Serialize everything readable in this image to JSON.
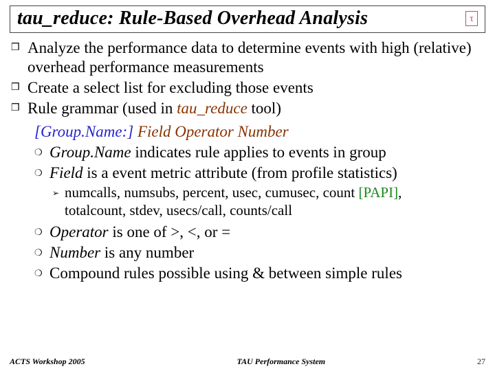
{
  "title": "tau_reduce: Rule-Based Overhead Analysis",
  "tau_mark": "τ",
  "bullets": {
    "b1": "Analyze the performance data to determine events with high (relative) overhead performance measurements",
    "b2": "Create a select list for excluding those events",
    "b3_pre": "Rule grammar (used in ",
    "b3_tool": "tau_reduce",
    "b3_post": " tool)"
  },
  "syntax": {
    "group": "[Group.Name:] ",
    "rest": "Field Operator Number"
  },
  "sub": {
    "s1_a": "Group.Name",
    "s1_b": " indicates rule applies to events in group",
    "s2_a": "Field",
    "s2_b": " is a event metric attribute (from profile statistics)"
  },
  "metrics": {
    "line1_a": "numcalls, numsubs, percent, usec, cumusec, count ",
    "line1_b": "[PAPI]",
    "line1_c": ",",
    "line2": "totalcount, stdev, usecs/call, counts/call"
  },
  "sub2": {
    "op_a": "Operator",
    "op_b": " is one of >, <, or =",
    "num_a": "Number",
    "num_b": " is any number",
    "comp": "Compound rules possible using & between simple rules"
  },
  "footer": {
    "left": "ACTS Workshop 2005",
    "center": "TAU Performance System",
    "page": "27"
  }
}
